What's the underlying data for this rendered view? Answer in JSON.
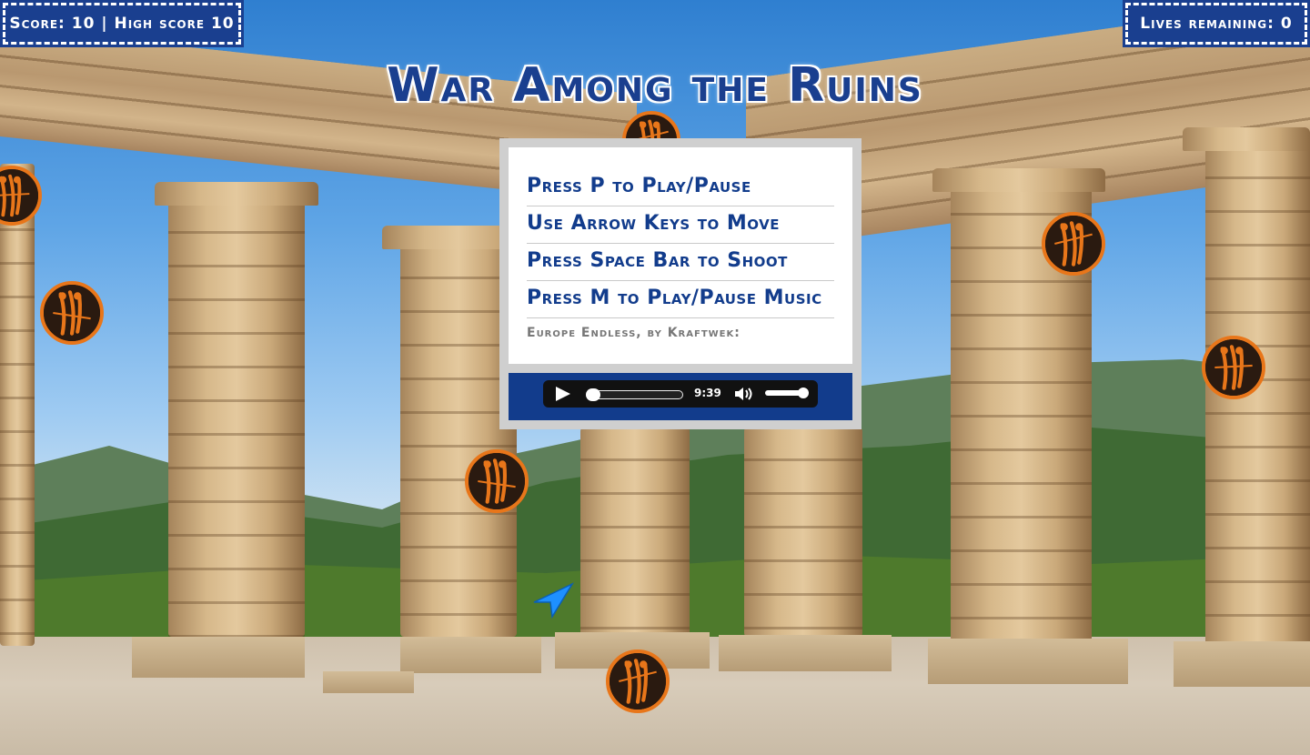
{
  "hud": {
    "score_text": "Score: 10 | High score 10",
    "lives_text": "Lives remaining: 0"
  },
  "title": "War Among the Ruins",
  "instructions": [
    "Press P to Play/Pause",
    "Use Arrow Keys to Move",
    "Press Space Bar to Shoot",
    "Press M to Play/Pause Music"
  ],
  "music_credit": "Europe Endless, by Kraftwek:",
  "audio_player": {
    "duration": "9:39",
    "progress": 0.0,
    "volume": 1.0
  },
  "enemies": {
    "count": 8,
    "icon": "greek-figure-medallion-icon"
  },
  "player_ship": {
    "icon": "arrow-ship-icon"
  },
  "colors": {
    "accent_blue": "#123c8c",
    "enemy_ring": "#e8761a",
    "ship": "#1e90ff"
  }
}
